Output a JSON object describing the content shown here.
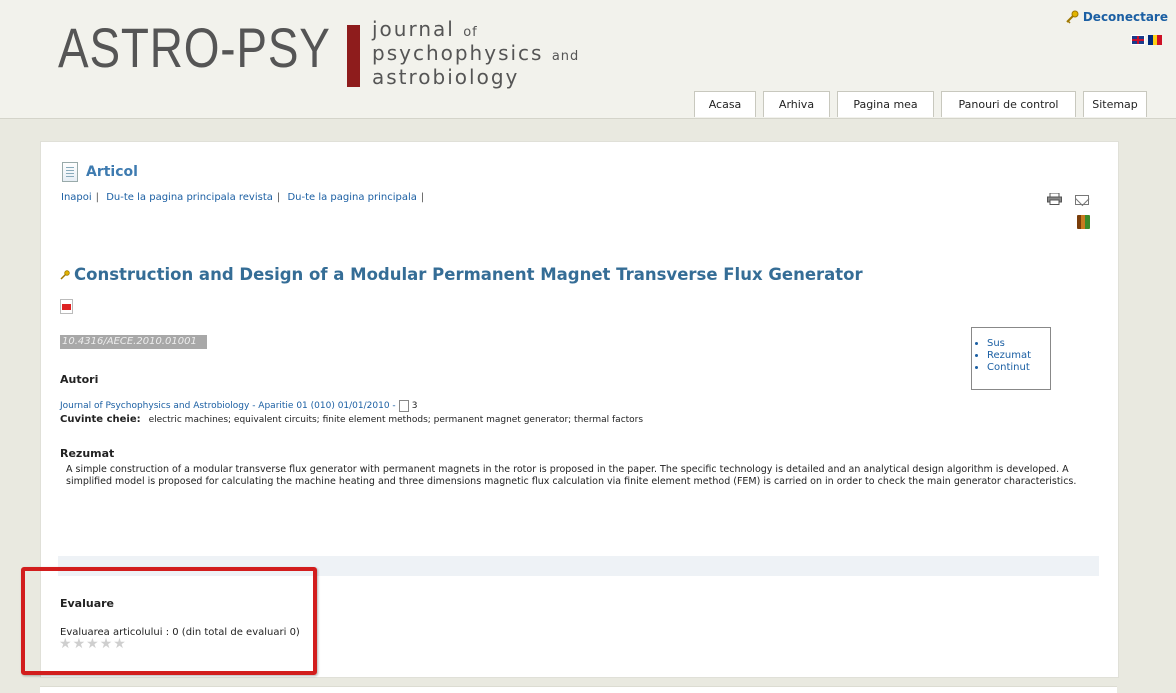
{
  "header": {
    "logo_main": "ASTRO-PSY",
    "logo_sub_line1_word": "journal",
    "logo_sub_line1_small": "of",
    "logo_sub_line2_word": "psychophysics",
    "logo_sub_line2_small": "and",
    "logo_sub_line3": "astrobiology",
    "logout_label": "Deconectare"
  },
  "nav": {
    "tabs": [
      {
        "label": "Acasa"
      },
      {
        "label": "Arhiva"
      },
      {
        "label": "Pagina mea"
      },
      {
        "label": "Panouri de control"
      },
      {
        "label": "Sitemap"
      }
    ]
  },
  "article": {
    "section_title": "Articol",
    "breadcrumbs": [
      "Inapoi",
      "Du-te la pagina principala revista",
      "Du-te la pagina principala"
    ],
    "title": "Construction and Design of a Modular Permanent Magnet Transverse Flux Generator",
    "doi": "10.4316/AECE.2010.01001",
    "toc": [
      "Sus",
      "Rezumat",
      "Continut"
    ],
    "authors_label": "Autori",
    "journal_ref": "Journal of Psychophysics and Astrobiology - Aparitie 01 (010) 01/01/2010 -",
    "page_count": "3",
    "keywords_label": "Cuvinte cheie:",
    "keywords": "electric machines; equivalent circuits; finite element methods; permanent magnet generator; thermal factors",
    "abstract_label": "Rezumat",
    "abstract_text": "A simple construction of a modular transverse flux generator with permanent magnets in the rotor is proposed in the paper. The specific technology is detailed and an analytical design algorithm is developed. A simplified model is proposed for calculating the machine heating and three dimensions magnetic flux calculation via finite element method (FEM) is carried on in order to check the main generator characteristics."
  },
  "rating": {
    "label": "Evaluare",
    "text": "Evaluarea articolului : 0 (din total de evaluari 0)",
    "stars_filled": 0,
    "stars_total": 5
  }
}
